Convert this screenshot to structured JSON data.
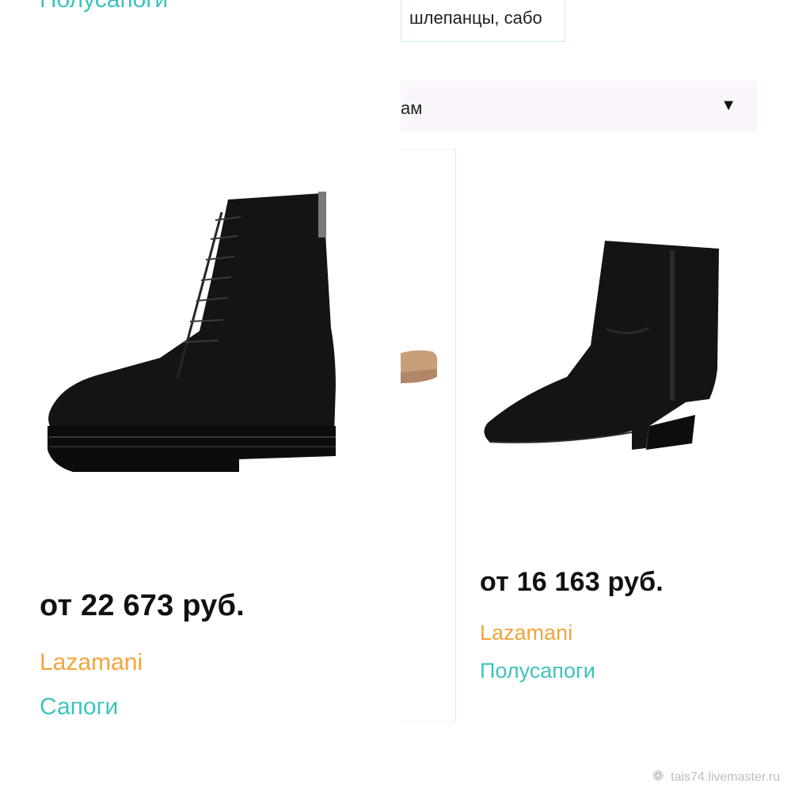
{
  "top_category": "Полусапоги",
  "filter_chip": "шлепанцы, сабо",
  "sort_select": {
    "value": "ам",
    "caret": "▼"
  },
  "products": [
    {
      "price": "от 22 673 руб.",
      "brand": "Lazamani",
      "category": "Сапоги"
    },
    {
      "price": "от 16 163 руб.",
      "brand": "Lazamani",
      "category": "Полусапоги"
    }
  ],
  "watermark": {
    "icon": "flower-icon",
    "text": "tais74.livemaster.ru"
  },
  "colors": {
    "accent_teal": "#3cc3be",
    "brand_orange": "#f2a43a",
    "text": "#111111"
  }
}
